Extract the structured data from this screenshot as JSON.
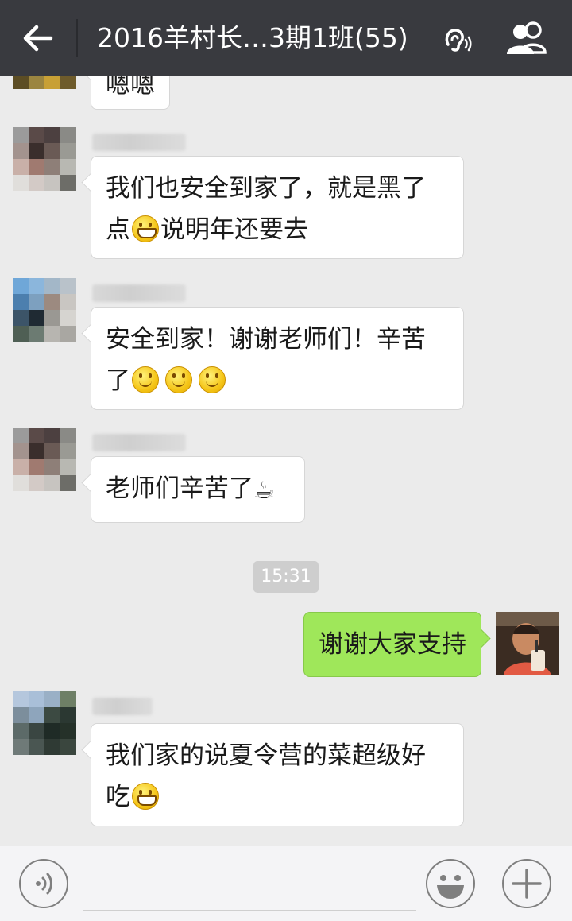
{
  "header": {
    "title": "2016羊村长…3期1班(55)",
    "back_icon": "back-arrow-icon",
    "ear_icon": "earpiece-icon",
    "members_icon": "group-members-icon",
    "bg_color": "#393a3f"
  },
  "messages": [
    {
      "sender": "other",
      "text": "嗯嗯"
    },
    {
      "sender": "other",
      "text_parts": [
        "我们也安全到家了，就是黑了",
        "点",
        "说明年还要去"
      ],
      "emoji": [
        "grin-emoji"
      ]
    },
    {
      "sender": "other",
      "text_parts": [
        "安全到家！谢谢老师们！辛苦",
        "了"
      ],
      "emoji": [
        "smile-emoji",
        "smile-emoji",
        "smile-emoji"
      ]
    },
    {
      "sender": "other",
      "text": "老师们辛苦了",
      "emoji": [
        "coffee-emoji"
      ]
    },
    {
      "timestamp": "15:31"
    },
    {
      "sender": "me",
      "text": "谢谢大家支持"
    },
    {
      "sender": "other",
      "text_parts": [
        "我们家的说夏令营的菜超级好",
        "吃"
      ],
      "emoji": [
        "grin-emoji"
      ]
    }
  ],
  "input_bar": {
    "voice_icon": "voice-input-icon",
    "text_value": "",
    "emoji_icon": "emoji-panel-icon",
    "plus_icon": "plus-icon"
  },
  "colors": {
    "chat_bg": "#ebebeb",
    "my_bubble": "#9fe75a",
    "other_bubble": "#ffffff"
  }
}
